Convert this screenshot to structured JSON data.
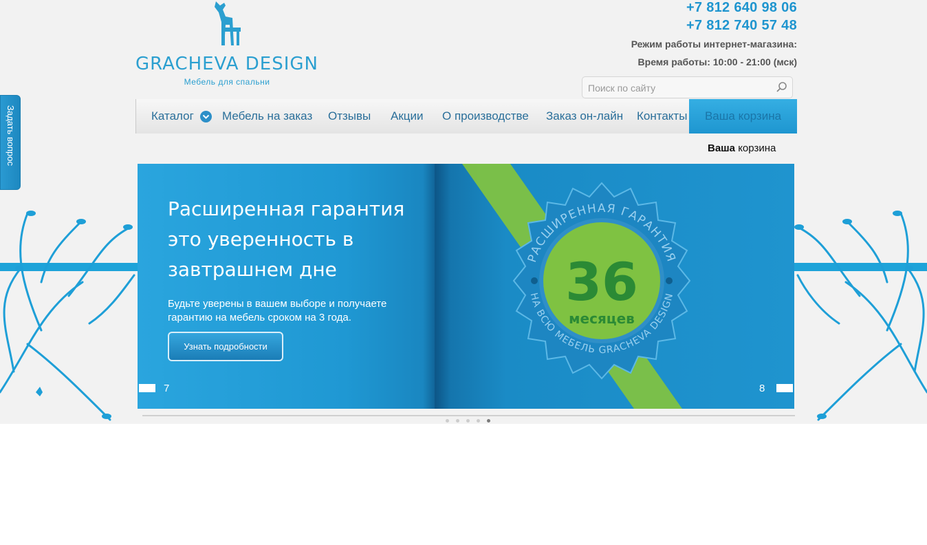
{
  "brand": {
    "name": "GRACHEVA DESIGN",
    "tagline": "Мебель для спальни"
  },
  "contacts": {
    "phone_1": "+7 812 640 98 06",
    "phone_2": "+7 812 740 57 48",
    "hours_label": "Режим работы интернет-магазина:",
    "hours_value": "Время работы: 10:00 - 21:00 (мск)"
  },
  "search": {
    "placeholder": "Поиск по сайту",
    "icon": "search-icon"
  },
  "nav": {
    "items": [
      {
        "label": "Каталог"
      },
      {
        "label": "Мебель на заказ"
      },
      {
        "label": "Отзывы"
      },
      {
        "label": "Акции"
      },
      {
        "label": "О производстве"
      },
      {
        "label": "Заказ он-лайн"
      },
      {
        "label": "Контакты"
      }
    ],
    "cart": "Ваша корзина",
    "catalog_dropdown_icon": "chevron-down-icon"
  },
  "cart_label": {
    "bold": "Ваша",
    "rest": " корзина"
  },
  "side_tab": {
    "label": "Задать вопрос"
  },
  "slide": {
    "title": "Расширенная гарантия это уверенность в завтрашнем дне",
    "text": "Будьте уверены в вашем выборе и получаете гарантию на мебель сроком на 3 года.",
    "button": "Узнать подробности",
    "prev_number": "7",
    "next_number": "8",
    "badge_number": "36",
    "badge_unit": "месяцев",
    "badge_arc_top": "РАСШИРЕННАЯ ГАРАНТИЯ",
    "badge_arc_bottom": "НА ВСЮ МЕБЕЛЬ GRACHEVA DESIGN"
  },
  "slider_pager": {
    "count": 5,
    "active_index": 4
  },
  "colors": {
    "brand_blue": "#1ea3d9",
    "nav_text": "#2a6f9a",
    "badge_green": "#7fc242"
  }
}
